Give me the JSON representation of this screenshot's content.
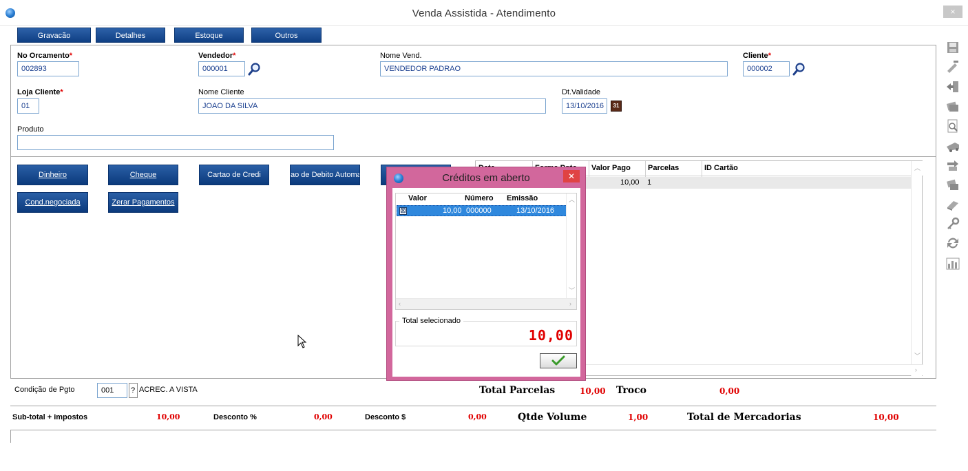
{
  "window": {
    "title": "Venda Assistida - Atendimento",
    "close_glyph": "×"
  },
  "tabs": [
    "Gravacão",
    "Detalhes",
    "Estoque",
    "Outros"
  ],
  "header": {
    "orcamento_label": "No Orcamento",
    "orcamento_value": "002893",
    "vendedor_label": "Vendedor",
    "vendedor_value": "000001",
    "nome_vend_label": "Nome Vend.",
    "nome_vend_value": "VENDEDOR PADRAO",
    "cliente_label": "Cliente",
    "cliente_value": "000002",
    "loja_label": "Loja Cliente",
    "loja_value": "01",
    "nome_cliente_label": "Nome Cliente",
    "nome_cliente_value": "JOAO DA SILVA",
    "validade_label": "Dt.Validade",
    "validade_value": "13/10/2016",
    "produto_label": "Produto",
    "produto_value": "",
    "required_mark": "*",
    "calendar_glyph": "31"
  },
  "payment_buttons": {
    "dinheiro": "Dinheiro",
    "cheque": "Cheque",
    "cartao_credito": "Cartao de Credi",
    "debito": "ao de Debito Automa",
    "cond_negociada": "Cond.negociada",
    "zerar": "Zerar Pagamentos"
  },
  "grid": {
    "headers": [
      "Data",
      "Forma Pgto",
      "Valor Pago",
      "Parcelas",
      "ID Cartão"
    ],
    "row": {
      "valor_pago": "10,00",
      "parcelas": "1"
    }
  },
  "condicao": {
    "label": "Condição de Pgto",
    "code": "001",
    "help": "?",
    "desc": "ACREC. A VISTA"
  },
  "totals": {
    "total_parcelas_label": "Total Parcelas",
    "total_parcelas_value": "10,00",
    "troco_label": "Troco",
    "troco_value": "0,00"
  },
  "footer": {
    "subtotal_label": "Sub-total + impostos",
    "subtotal_value": "10,00",
    "desc_pct_label": "Desconto %",
    "desc_pct_value": "0,00",
    "desc_val_label": "Desconto $",
    "desc_val_value": "0,00",
    "qtde_label": "Qtde Volume",
    "qtde_value": "1,00",
    "merc_label": "Total de Mercadorias",
    "merc_value": "10,00"
  },
  "toolbar_icons": [
    "save-icon",
    "tools-icon",
    "exit-icon",
    "money-icon",
    "preview-icon",
    "truck-icon",
    "exchange-icon",
    "coins-icon",
    "eraser-icon",
    "key-icon",
    "refresh-icon",
    "chart-icon"
  ],
  "dialog": {
    "title": "Créditos em aberto",
    "close_glyph": "✕",
    "headers": [
      "Valor",
      "Número",
      "Emissão"
    ],
    "row": {
      "checked": "☒",
      "valor": "10,00",
      "numero": "000000",
      "emissao": "13/10/2016"
    },
    "total_label": "Total selecionado",
    "total_value": "10,00"
  },
  "colors": {
    "accent": "#0f3f84",
    "dialog_frame": "#d2679c",
    "highlight": "#2f88dd",
    "red": "#e00000"
  }
}
